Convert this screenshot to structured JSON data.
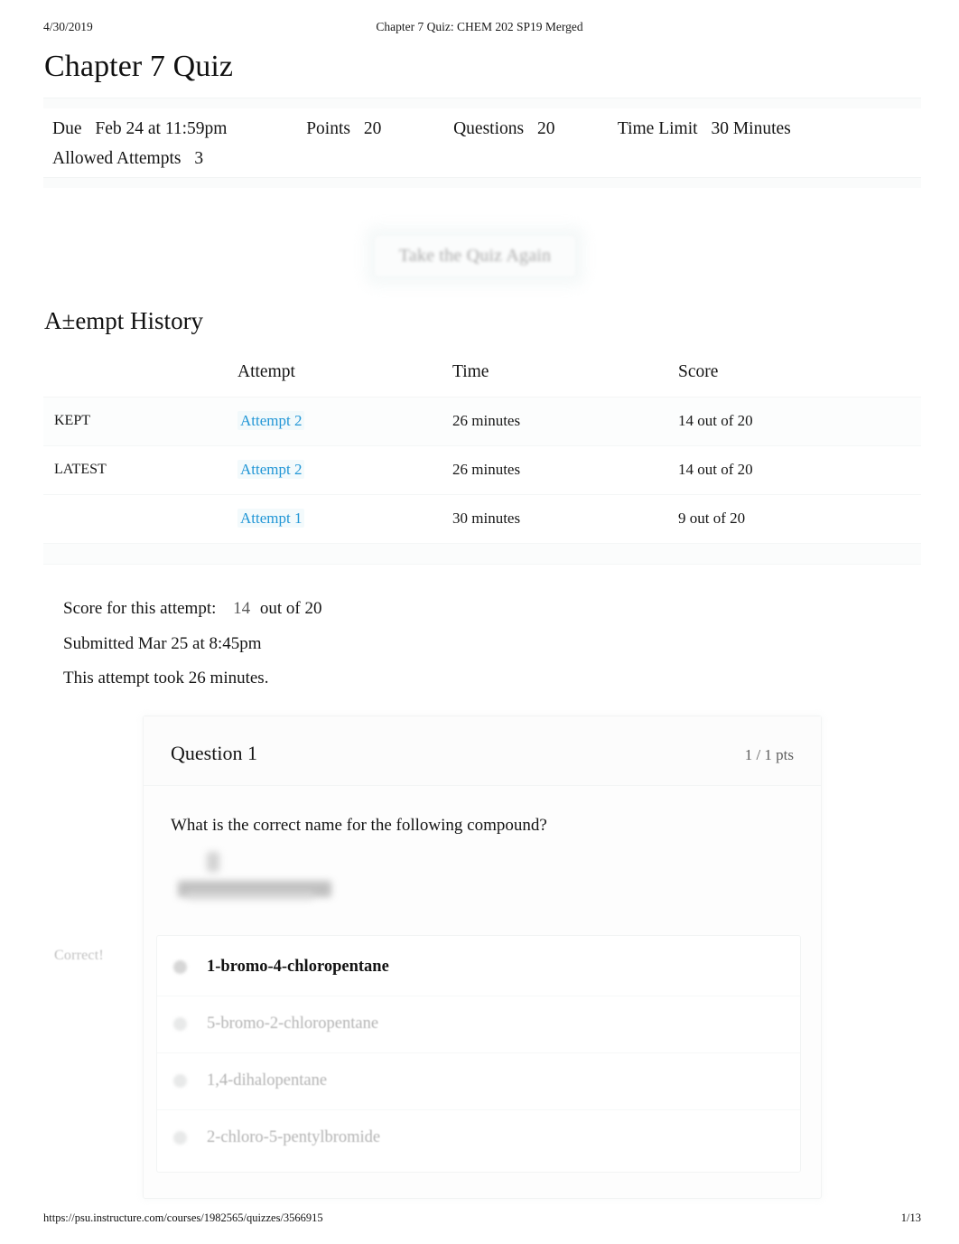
{
  "print": {
    "date": "4/30/2019",
    "doc_title": "Chapter 7 Quiz: CHEM 202 SP19 Merged",
    "url": "https://psu.instructure.com/courses/1982565/quizzes/3566915",
    "page_number": "1/13"
  },
  "quiz": {
    "title": "Chapter 7 Quiz",
    "meta": {
      "due_label": "Due",
      "due_value": "Feb 24 at 11:59pm",
      "points_label": "Points",
      "points_value": "20",
      "questions_label": "Questions",
      "questions_value": "20",
      "time_limit_label": "Time Limit",
      "time_limit_value": "30 Minutes",
      "allowed_attempts_label": "Allowed Attempts",
      "allowed_attempts_value": "3"
    },
    "retake_button": "Take the Quiz Again"
  },
  "attempt_history": {
    "heading": "A±empt History",
    "columns": {
      "tag": "",
      "attempt": "Attempt",
      "time": "Time",
      "score": "Score"
    },
    "rows": [
      {
        "tag": "KEPT",
        "attempt": "Attempt 2",
        "time": "26 minutes",
        "score": "14 out of 20"
      },
      {
        "tag": "LATEST",
        "attempt": "Attempt 2",
        "time": "26 minutes",
        "score": "14 out of 20"
      },
      {
        "tag": "",
        "attempt": "Attempt 1",
        "time": "30 minutes",
        "score": "9 out of 20"
      }
    ]
  },
  "attempt_summary": {
    "score_label": "Score for this attempt:",
    "score_value": "14",
    "score_suffix": "out of 20",
    "submitted": "Submitted Mar 25 at 8:45pm",
    "duration": "This attempt took 26 minutes."
  },
  "question": {
    "number_label": "Question 1",
    "points": "1 / 1 pts",
    "prompt": "What is the correct name for the following compound?",
    "result_flag": "Correct!",
    "answers": [
      {
        "label": "1-bromo-4-chloropentane",
        "selected": true
      },
      {
        "label": "5-bromo-2-chloropentane",
        "selected": false
      },
      {
        "label": "1,4-dihalopentane",
        "selected": false
      },
      {
        "label": "2-chloro-5-pentylbromide",
        "selected": false
      }
    ]
  },
  "colors": {
    "link_blue": "#2196d6",
    "text": "#151515",
    "muted": "#b4b4b4"
  }
}
